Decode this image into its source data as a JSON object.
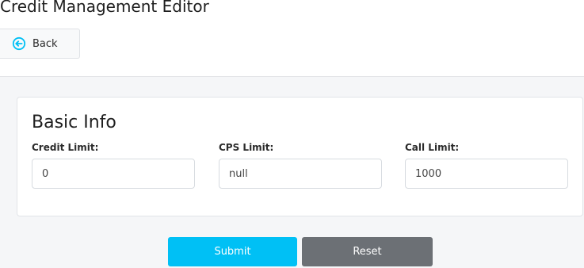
{
  "header": {
    "title": "Credit Management Editor",
    "back_label": "Back",
    "back_icon": "circle-arrow-left-icon",
    "accent_color": "#00c0f5"
  },
  "basic_info": {
    "title": "Basic Info",
    "fields": [
      {
        "label": "Credit Limit:",
        "value": "0"
      },
      {
        "label": "CPS Limit:",
        "value": "null"
      },
      {
        "label": "Call Limit:",
        "value": "1000"
      }
    ]
  },
  "actions": {
    "submit_label": "Submit",
    "reset_label": "Reset",
    "submit_color": "#00c0f5",
    "reset_color": "#6c7075"
  }
}
